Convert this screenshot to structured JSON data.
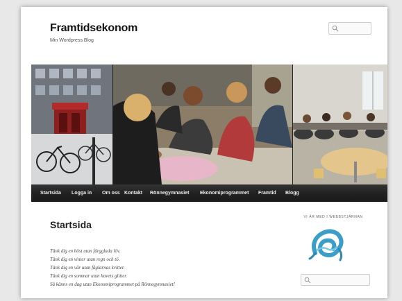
{
  "site": {
    "title": "Framtidsekonom",
    "description": "Min Wordpress Blog"
  },
  "search": {
    "top_icon": "search-icon",
    "sidebar_icon": "search-icon"
  },
  "banner": {
    "photos": [
      "school-entrance-photo",
      "students-at-table-photo",
      "classroom-photo"
    ]
  },
  "nav": {
    "items": [
      {
        "label": "Startsida"
      },
      {
        "label": "Logga in"
      },
      {
        "label": "Om oss"
      },
      {
        "label": "Kontakt"
      },
      {
        "label": "Rönnegymnasiet"
      },
      {
        "label": "Ekonomiprogrammet"
      },
      {
        "label": "Framtid"
      },
      {
        "label": "Blogg"
      }
    ]
  },
  "main": {
    "title": "Startsida",
    "lines": [
      "Tänk dig en höst utan färgglada löv.",
      "Tänk dig en vinter utan regn och tö.",
      "Tänk dig en vår utan fåglarnas kvitter.",
      "Tänk dig en sommar utan havets glitter.",
      "Så känns en dag utan Ekonomiprogrammet på Rönnegymnasiet!"
    ]
  },
  "sidebar": {
    "widget_title": "VI ÄR MED I WEBBSTJÄRNAN",
    "logo_icon": "webbstjarnan-ribbon-logo"
  },
  "colors": {
    "navbar": "#222222",
    "logo": "#3a9ec9"
  }
}
